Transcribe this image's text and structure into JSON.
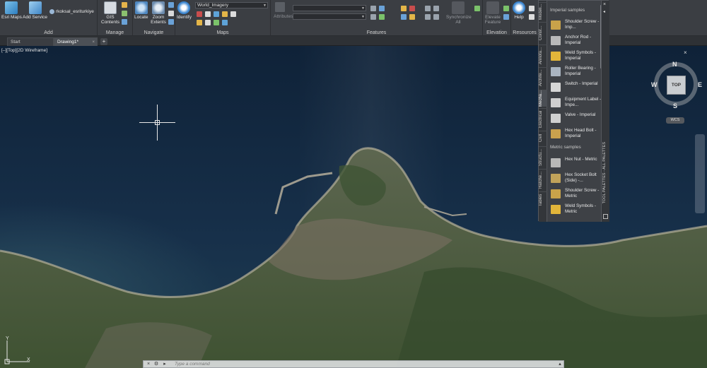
{
  "ribbon": {
    "panels": {
      "add": "Add",
      "manage": "Manage",
      "navigate": "Navigate",
      "maps": "Maps",
      "features": "Features",
      "elevation": "Elevation",
      "resources": "Resources"
    },
    "buttons": {
      "esri_maps": "Esri Maps",
      "add_service": "Add Service",
      "user": "rkoksal_esriturkiye",
      "gis_contents": "GIS Contents",
      "locate": "Locate",
      "zoom_extents": "Zoom Extents",
      "identify": "Identify",
      "synchronize": "Synchronize All",
      "elevation_btn": "Elevate Feature",
      "help": "Help"
    },
    "basemap_select": "World_Imagery",
    "attributes_label": "Attributes"
  },
  "tabs": [
    {
      "label": "Start"
    },
    {
      "label": "Drawing1*"
    }
  ],
  "view_label": "[–][Top][2D Wireframe]",
  "viewcube": {
    "top": "TOP",
    "n": "N",
    "s": "S",
    "e": "E",
    "w": "W",
    "wcs": "WCS"
  },
  "palette": {
    "side_title": "TOOL PALETTES - ALL PALETTES",
    "tabs": [
      "Modeli...",
      "Const...",
      "Annota...",
      "Archite...",
      "Mecha...",
      "Electrical",
      "Civil",
      "Structu...",
      "Hatche...",
      "Tables"
    ],
    "sections": {
      "imperial": "Imperial samples",
      "metric": "Metric samples"
    },
    "imperial_items": [
      {
        "label": "Shoulder Screw - Imp...",
        "color": "#c8a24a"
      },
      {
        "label": "Anchor Rod - Imperial",
        "color": "#b9b9b9"
      },
      {
        "label": "Weld Symbols - Imperial",
        "color": "#e2b53a"
      },
      {
        "label": "Roller Bearing - Imperial",
        "color": "#a9b4c0"
      },
      {
        "label": "Switch - Imperial",
        "color": "#d6d6d6"
      },
      {
        "label": "Equipment Label - Impe...",
        "color": "#cfcfcf"
      },
      {
        "label": "Valve - Imperial",
        "color": "#d0d0d0"
      },
      {
        "label": "Hex Head Bolt - Imperial",
        "color": "#c9a14e"
      }
    ],
    "metric_items": [
      {
        "label": "Hex Nut - Metric",
        "color": "#b8b8b8"
      },
      {
        "label": "Hex Socket Bolt (Side) -...",
        "color": "#c1a35a"
      },
      {
        "label": "Shoulder Screw - Metric",
        "color": "#c8a24a"
      },
      {
        "label": "Weld Symbols - Metric",
        "color": "#e2b53a"
      }
    ]
  },
  "command": {
    "placeholder": "Type a command"
  },
  "ucs": {
    "x": "X",
    "y": "Y"
  },
  "colors": {
    "ribbon": "#3b3e43",
    "sea_deep": "#12263f",
    "sea_shallow": "#2a4a5c",
    "land": "#4b5a3e"
  }
}
